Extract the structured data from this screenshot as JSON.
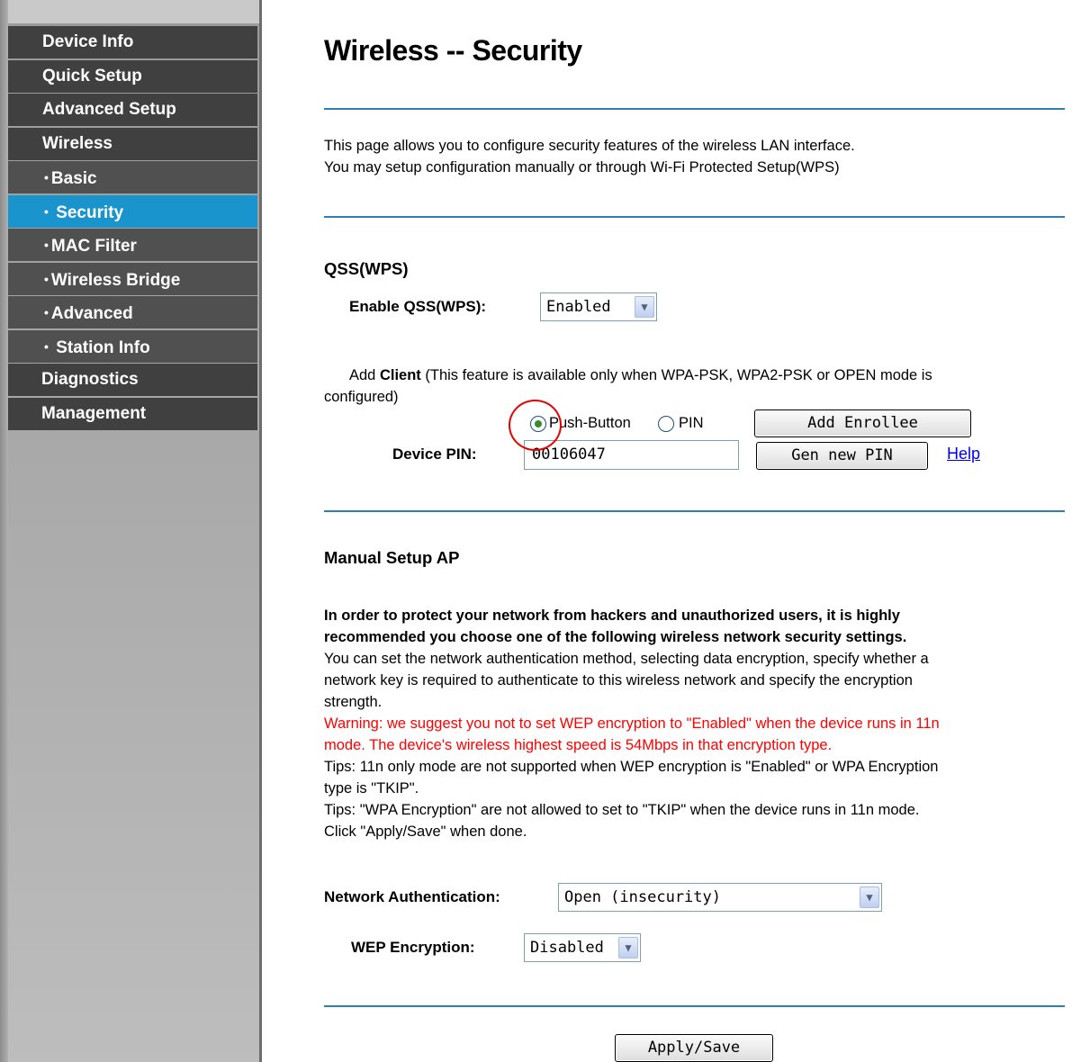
{
  "sidebar": {
    "items": [
      {
        "label": "Device Info"
      },
      {
        "label": "Quick Setup"
      },
      {
        "label": "Advanced Setup"
      },
      {
        "label": "Wireless"
      },
      {
        "label": "Basic"
      },
      {
        "label": "Security"
      },
      {
        "label": "MAC Filter"
      },
      {
        "label": "Wireless Bridge"
      },
      {
        "label": "Advanced"
      },
      {
        "label": "Station Info"
      },
      {
        "label": "Diagnostics"
      },
      {
        "label": "Management"
      }
    ],
    "bullet": "•",
    "active_item": "Security"
  },
  "page": {
    "title": "Wireless -- Security",
    "intro_line1": "This page allows you to configure security features of the wireless LAN interface.",
    "intro_line2": "You may setup configuration manually or through Wi-Fi Protected Setup(WPS)"
  },
  "qss": {
    "heading": "QSS(WPS)",
    "enable_label": "Enable QSS(WPS):",
    "enable_value": "Enabled",
    "add_client_prefix": "Add ",
    "add_client_bold": "Client",
    "add_client_suffix": " (This feature is available only when WPA-PSK, WPA2-PSK or OPEN mode is",
    "add_client_line2": "configured)",
    "radio_push_label": "Push-Button",
    "radio_pin_label": "PIN",
    "selected_radio": "Push-Button",
    "add_enrollee_button": "Add Enrollee",
    "device_pin_label": "Device PIN:",
    "device_pin_value": "00106047",
    "gen_pin_button": "Gen new PIN",
    "help_link": "Help"
  },
  "manual": {
    "heading": "Manual Setup AP",
    "bold_line1": "In order to protect your network from hackers and unauthorized users, it is highly",
    "bold_line2": "recommended you choose one of the following wireless network security settings.",
    "line3": "You can set the network authentication method, selecting data encryption, specify whether a",
    "line4": "network key is required to authenticate to this wireless network and specify the encryption",
    "line5": "strength.",
    "warning_line1": "Warning: we suggest you not to set WEP encryption to \"Enabled\" when the device runs in 11n",
    "warning_line2": "mode. The device's wireless highest speed is 54Mbps in that encryption type.",
    "tips1_line1": "Tips: 11n only mode are not supported when WEP encryption is \"Enabled\" or WPA Encryption",
    "tips1_line2": "type is \"TKIP\".",
    "tips2_line": "Tips: \"WPA Encryption\" are not allowed to set to \"TKIP\" when the device runs in 11n mode.",
    "click_line": "Click \"Apply/Save\" when done.",
    "auth_label": "Network Authentication:",
    "auth_value": "Open (insecurity)",
    "wep_label": "WEP Encryption:",
    "wep_value": "Disabled",
    "apply_button": "Apply/Save"
  },
  "colors": {
    "sidebar_item_bg": "#404040",
    "sidebar_active_bg": "#1a94cc",
    "divider": "#2d7fb4",
    "warning_text": "#ff0000",
    "annotation_circle": "#e60000"
  }
}
